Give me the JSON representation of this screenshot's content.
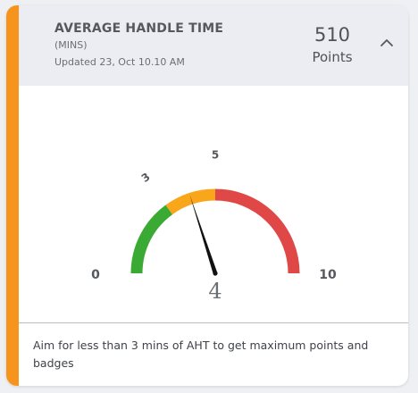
{
  "card": {
    "title": "AVERAGE HANDLE TIME",
    "units": "(MINS)",
    "updated": "Updated 23, Oct 10.10 AM",
    "points_value": "510",
    "points_label": "Points",
    "accent_color": "#f7941d",
    "collapse_icon": "chevron-up-icon"
  },
  "gauge": {
    "value": 4,
    "value_label": "4",
    "min": 0,
    "max": 10,
    "min_label": "0",
    "max_label": "10",
    "tick_labels": [
      {
        "text": "3",
        "value": 3
      },
      {
        "text": "5",
        "value": 5
      }
    ],
    "bands": [
      {
        "from": 0,
        "to": 3,
        "color": "#3aaa35"
      },
      {
        "from": 3,
        "to": 5,
        "color": "#f9a61a"
      },
      {
        "from": 5,
        "to": 10,
        "color": "#e04848"
      }
    ],
    "needle_color": "#111111"
  },
  "footer": {
    "message": "Aim for less than 3 mins of AHT to get maximum points and badges"
  }
}
